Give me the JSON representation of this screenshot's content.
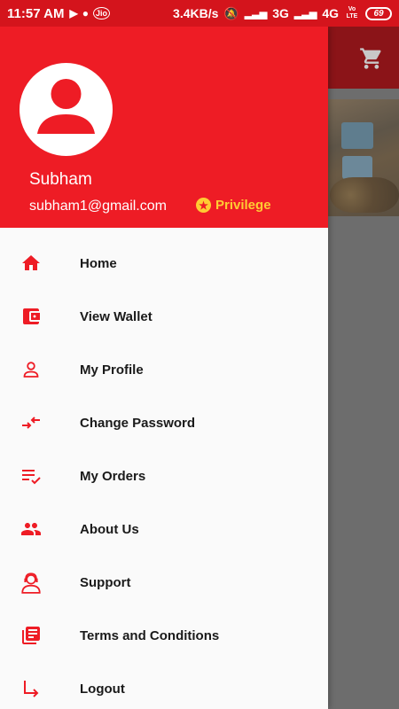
{
  "status_bar": {
    "time": "11:57 AM",
    "network_speed": "3.4KB/s",
    "network_3g": "3G",
    "network_4g": "4G",
    "volte": "Vo LTE",
    "battery": "69",
    "carrier_badge": "Jio"
  },
  "drawer": {
    "user_name": "Subham",
    "user_email": "subham1@gmail.com",
    "privilege_label": "Privilege",
    "menu": [
      {
        "label": "Home",
        "icon": "home-icon"
      },
      {
        "label": "View Wallet",
        "icon": "wallet-icon"
      },
      {
        "label": "My Profile",
        "icon": "profile-icon"
      },
      {
        "label": "Change Password",
        "icon": "swap-arrows-icon"
      },
      {
        "label": "My Orders",
        "icon": "orders-checklist-icon"
      },
      {
        "label": "About Us",
        "icon": "group-icon"
      },
      {
        "label": "Support",
        "icon": "support-agent-icon"
      },
      {
        "label": "Terms and Conditions",
        "icon": "document-list-icon"
      },
      {
        "label": "Logout",
        "icon": "logout-arrow-icon"
      }
    ]
  },
  "colors": {
    "primary": "#ee1c25",
    "status_bar": "#d4141c",
    "privilege": "#ffcc33",
    "menu_text": "#1a1a1a"
  }
}
